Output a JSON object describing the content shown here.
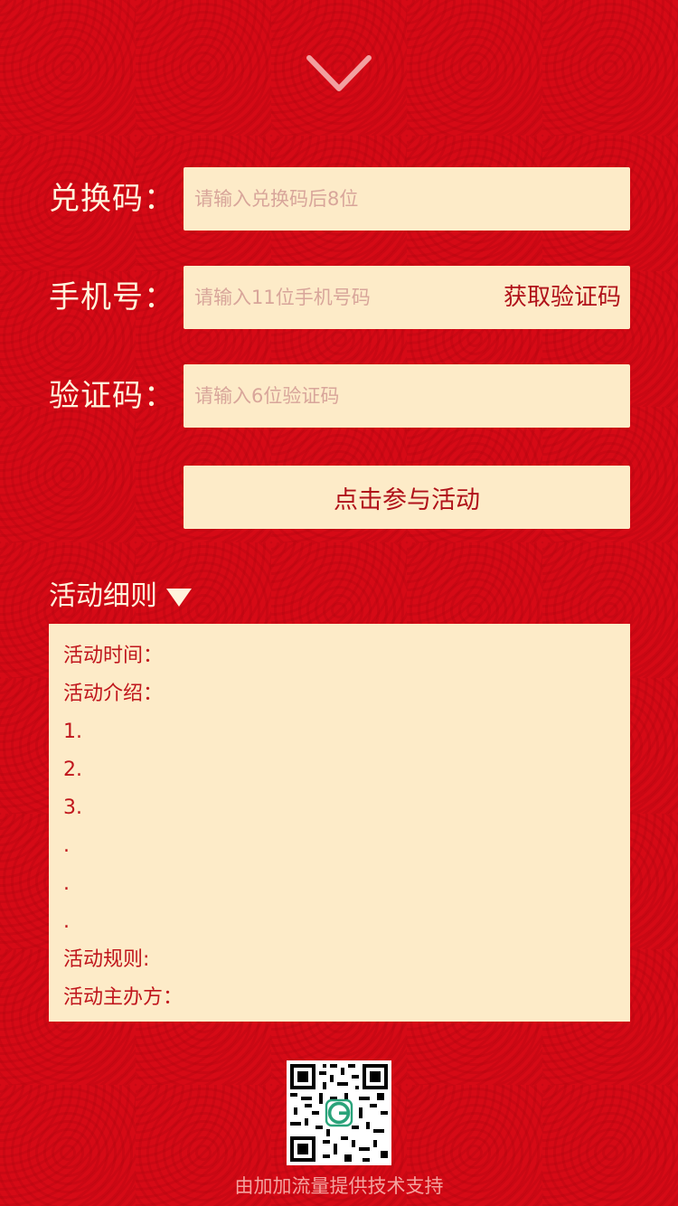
{
  "form": {
    "redeem_label": "兑换码：",
    "redeem_placeholder": "请输入兑换码后8位",
    "phone_label": "手机号：",
    "phone_placeholder": "请输入11位手机号码",
    "get_code_label": "获取验证码",
    "code_label": "验证码：",
    "code_placeholder": "请输入6位验证码",
    "submit_label": "点击参与活动"
  },
  "rules": {
    "title": "活动细则",
    "lines": [
      "活动时间：",
      "活动介绍：",
      "1.",
      "2.",
      "3.",
      ".",
      ".",
      ".",
      "活动规则:",
      "活动主办方："
    ]
  },
  "footer": {
    "support_text": "由加加流量提供技术支持"
  },
  "colors": {
    "background": "#d60a16",
    "panel": "#fdebc8",
    "accent_text": "#b0121a"
  },
  "icons": {
    "top": "chevron-down-icon",
    "rules_toggle": "triangle-down-icon",
    "qr": "qr-code-icon"
  }
}
